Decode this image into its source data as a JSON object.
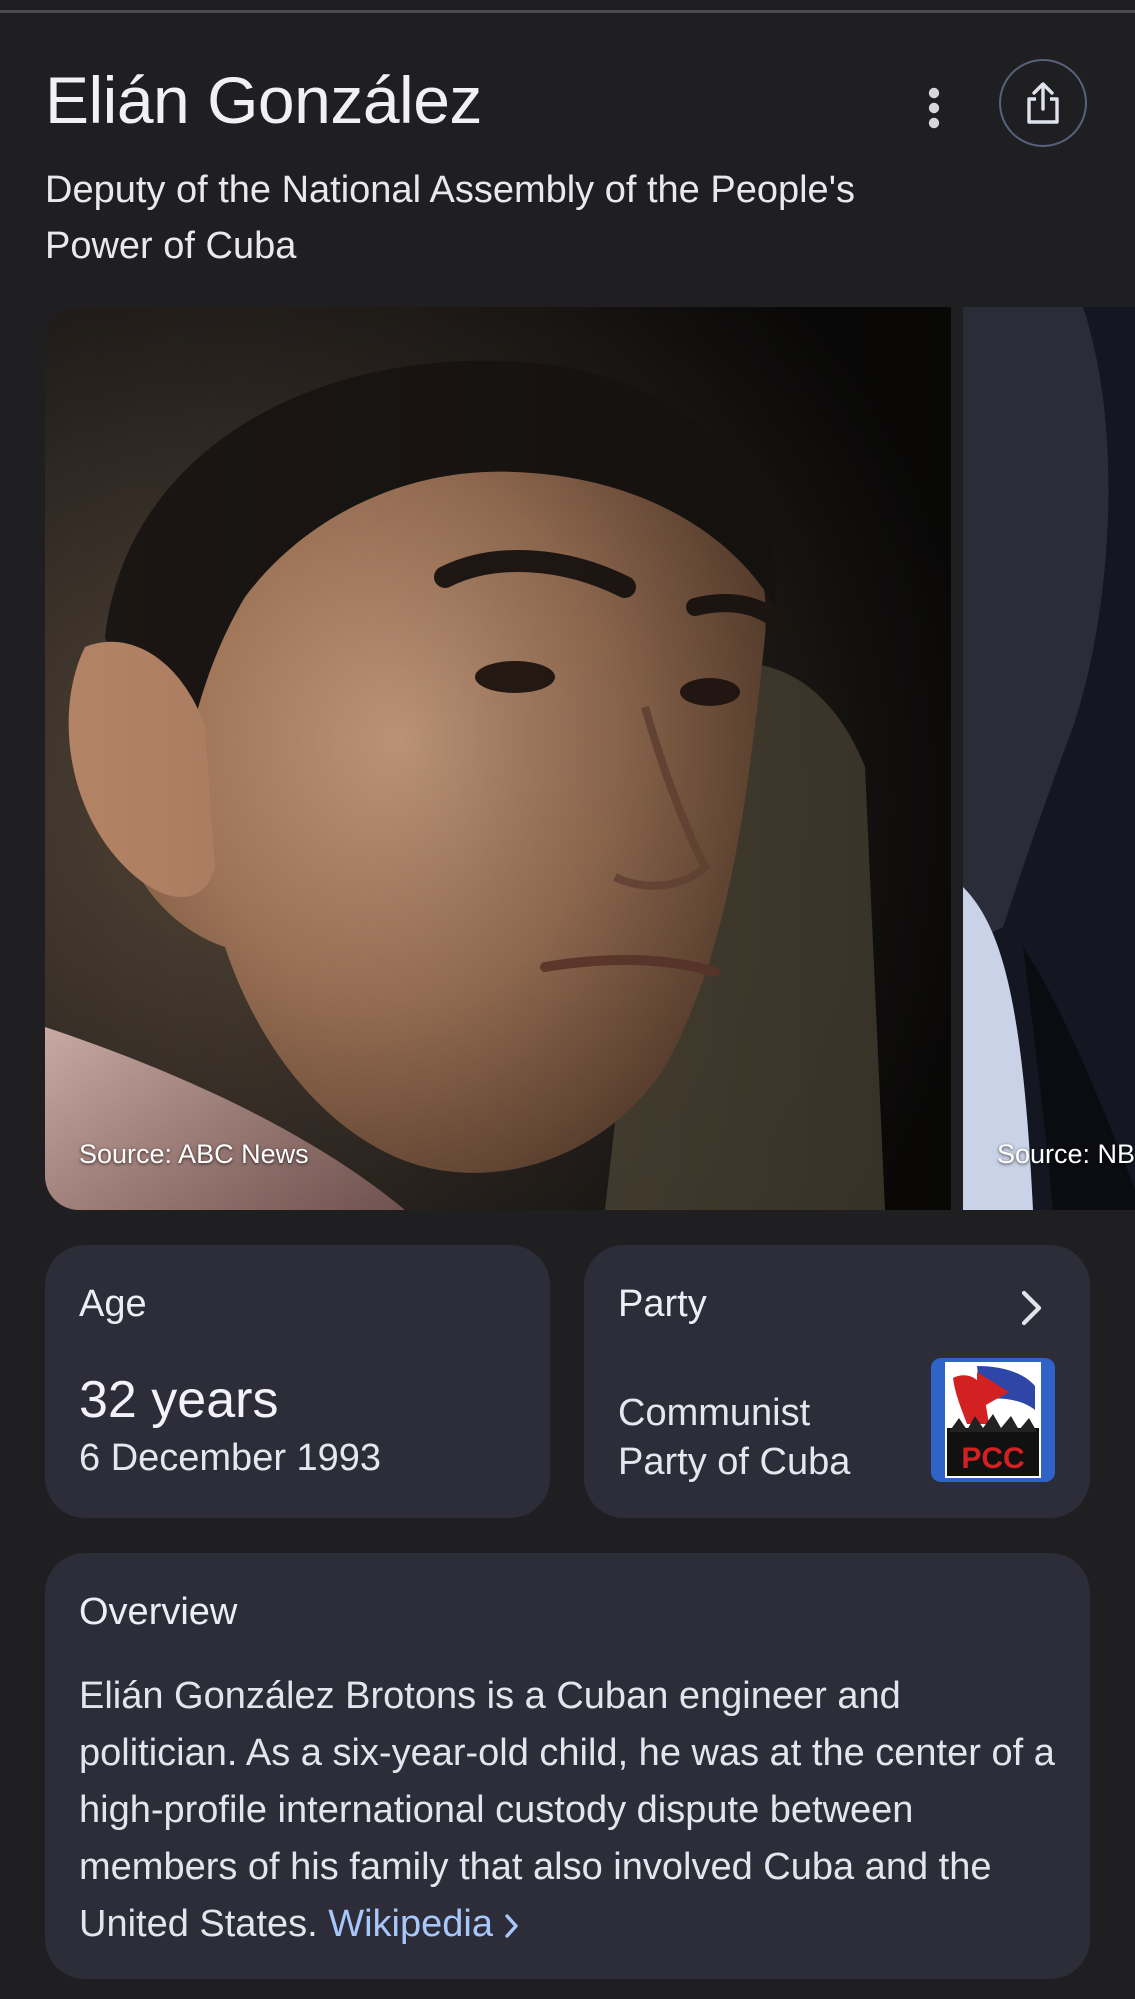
{
  "header": {
    "title": "Elián González",
    "subtitle": "Deputy of the National Assembly of the People's Power of Cuba"
  },
  "carousel": {
    "images": [
      {
        "source": "Source: ABC News"
      },
      {
        "source": "Source: NB"
      }
    ]
  },
  "age_card": {
    "heading": "Age",
    "value": "32 years",
    "birth_date": "6 December 1993"
  },
  "party_card": {
    "heading": "Party",
    "name": "Communist Party of Cuba",
    "logo_text": "PCC"
  },
  "overview": {
    "heading": "Overview",
    "text": "Elián González Brotons is a Cuban engineer and politician. As a six-year-old child, he was at the center of a high-profile international custody dispute between members of his family that also involved Cuba and the United States.",
    "link_label": "Wikipedia"
  },
  "icons": {
    "more": "more-vert-icon",
    "share": "share-icon",
    "chevron": "chevron-right-icon"
  },
  "colors": {
    "background": "#1f1f21",
    "card": "#2c2d39",
    "link": "#a8c7fa"
  }
}
